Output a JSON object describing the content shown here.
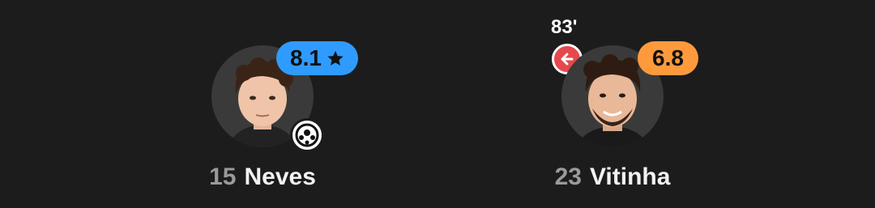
{
  "players": [
    {
      "number": "15",
      "name": "Neves",
      "rating": "8.1",
      "rating_color": "#2f9bff",
      "rating_icon": "star-icon",
      "event_icon": "football-icon"
    },
    {
      "number": "23",
      "name": "Vitinha",
      "rating": "6.8",
      "rating_color": "#ff9a3c",
      "substitution_minute": "83'",
      "substitution_icon": "arrow-left-icon"
    }
  ]
}
